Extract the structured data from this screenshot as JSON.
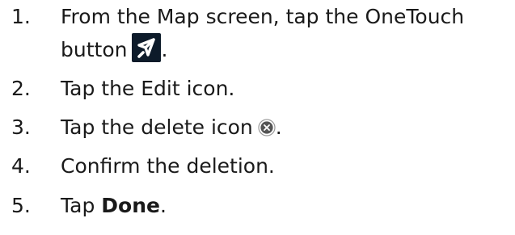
{
  "steps": [
    {
      "number": "1.",
      "text_line1": "From the Map screen, tap the OneTouch",
      "text_line2_before": "button",
      "text_line2_after": ".",
      "icon": "onetouch-icon"
    },
    {
      "number": "2.",
      "text": "Tap the Edit icon."
    },
    {
      "number": "3.",
      "text_before": "Tap the delete icon",
      "text_after": ".",
      "icon": "delete-icon"
    },
    {
      "number": "4.",
      "text": "Confirm the deletion."
    },
    {
      "number": "5.",
      "text_before": "Tap ",
      "bold": "Done",
      "text_after": "."
    }
  ],
  "colors": {
    "text": "#1a1a1a",
    "icon_bg": "#0d1b2a",
    "delete_icon": "#555555"
  }
}
